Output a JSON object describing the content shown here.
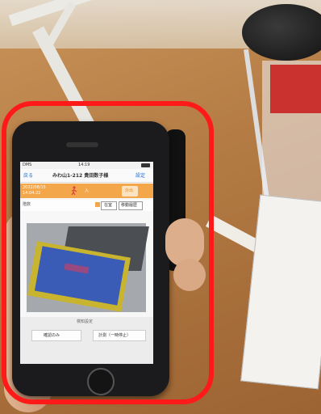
{
  "status": {
    "carrier": "DMS",
    "time": "14:19"
  },
  "nav": {
    "back": "戻る",
    "title": "みわ山1-212 貴田数子様",
    "settings": "設定"
  },
  "visit": {
    "date": "2022/08/15",
    "clock": "14:04:22",
    "label": "入",
    "side_label": "外出"
  },
  "toolbar": {
    "floor_label": "階数",
    "sonar": "在室",
    "move": "移動履歴"
  },
  "panel": {
    "heading": "検知設定",
    "confirm": "確認のみ",
    "stop": "計測（一時停止）"
  },
  "icons": {
    "person": "walking-person-icon"
  },
  "colors": {
    "accent": "#f3a64a",
    "highlight": "#ff1a1a"
  }
}
